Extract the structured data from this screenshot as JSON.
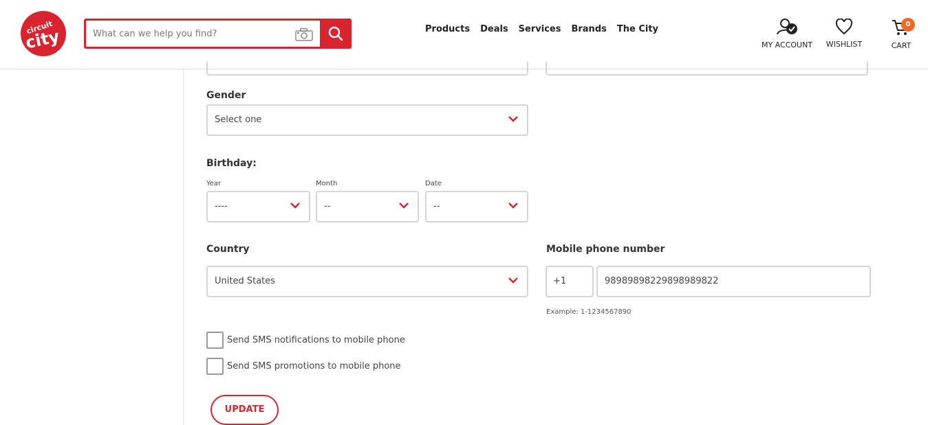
{
  "header": {
    "logo_text": "circuit city",
    "search": {
      "placeholder": "What can we help you find?",
      "value": ""
    },
    "nav": [
      "Products",
      "Deals",
      "Services",
      "Brands",
      "The City"
    ],
    "my_account": "MY ACCOUNT",
    "wishlist": "WISHLIST",
    "cart": "CART",
    "cart_count": "0",
    "brand_color": "#d9232e",
    "badge_color": "#f26a22"
  },
  "form": {
    "gender": {
      "label": "Gender",
      "value": "Select one"
    },
    "birthday": {
      "label": "Birthday:",
      "year": {
        "label": "Year",
        "value": "----"
      },
      "month": {
        "label": "Month",
        "value": "--"
      },
      "date": {
        "label": "Date",
        "value": "--"
      }
    },
    "country": {
      "label": "Country",
      "value": "United States"
    },
    "mobile": {
      "label": "Mobile phone number",
      "code": "+1",
      "number": "98989898229898989822",
      "example": "Example: 1-1234567890"
    },
    "sms_notifications": {
      "label": "Send SMS notifications to mobile phone",
      "checked": false
    },
    "sms_promotions": {
      "label": "Send SMS promotions to mobile phone",
      "checked": false
    },
    "update_button": "UPDATE"
  }
}
